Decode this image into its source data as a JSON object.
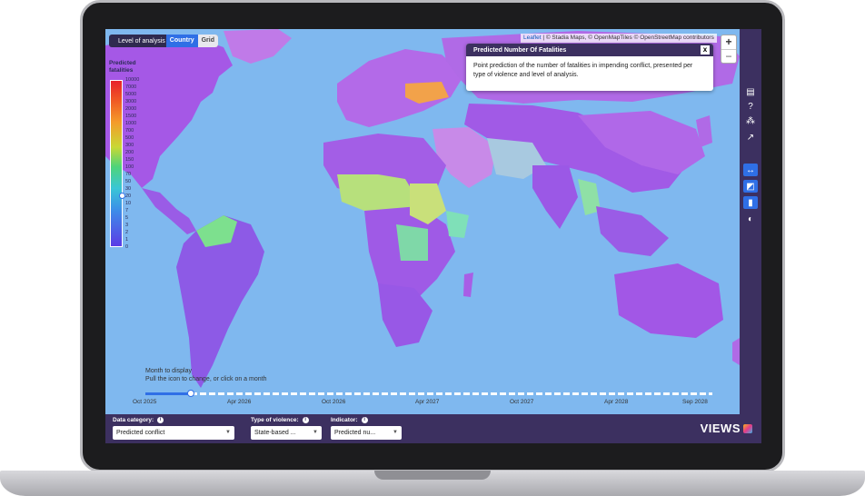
{
  "map": {
    "attribution_leaflet": "Leaflet",
    "attribution_rest": " | © Stadia Maps, © OpenMapTiles © OpenStreetMap contributors",
    "zoom_in": "+",
    "zoom_out": "−"
  },
  "level": {
    "label": "Level of analysis",
    "options": [
      "Country",
      "Grid"
    ],
    "selected": "Country"
  },
  "legend": {
    "title": "Predicted fatalities",
    "ticks": [
      "10000",
      "7000",
      "5000",
      "3000",
      "2000",
      "1500",
      "1000",
      "700",
      "500",
      "300",
      "200",
      "150",
      "100",
      "70",
      "50",
      "30",
      "20",
      "10",
      "7",
      "5",
      "3",
      "2",
      "1",
      "0"
    ]
  },
  "popup": {
    "title": "Predicted Number Of Fatalities",
    "close": "x",
    "body": "Point prediction of the number of fatalities in impending conflict, presented per type of violence and level of analysis."
  },
  "timeline": {
    "title": "Month to display",
    "hint": "Pull the icon to change, or click on a month",
    "ticks": [
      "Oct 2025",
      "Apr 2026",
      "Oct 2026",
      "Apr 2027",
      "Oct 2027",
      "Apr 2028",
      "Sep 2028"
    ],
    "selected_fraction": 0.08
  },
  "controls": {
    "data_category": {
      "label": "Data category:",
      "value": "Predicted conflict"
    },
    "violence": {
      "label": "Type of violence:",
      "value": "State-based ..."
    },
    "indicator": {
      "label": "Indicator:",
      "value": "Predicted nu..."
    }
  },
  "brand": "VIEWS",
  "icons": {
    "rail": [
      "book-icon",
      "help-icon",
      "share-icon",
      "chart-icon",
      "resize-width-icon",
      "image-icon",
      "panel-icon",
      "contrast-icon"
    ],
    "rail_glyphs": [
      "▤",
      "?",
      "⁂",
      "↗",
      "↔",
      "◩",
      "▮",
      "◐"
    ]
  },
  "colors": {
    "accent": "#2f6fe6",
    "panel": "#3c3060",
    "ocean": "#7fb8ef",
    "land_low": "#a95be6",
    "land_mid": "#b7e07c",
    "land_high": "#f2a24a"
  }
}
